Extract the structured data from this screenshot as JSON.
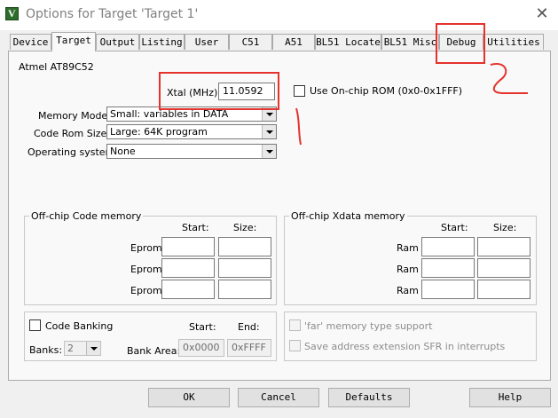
{
  "window": {
    "title": "Options for Target 'Target 1'",
    "close": "✕",
    "icon_letter": "V"
  },
  "tabs": [
    {
      "label": "Device"
    },
    {
      "label": "Target"
    },
    {
      "label": "Output"
    },
    {
      "label": "Listing"
    },
    {
      "label": "User"
    },
    {
      "label": "C51"
    },
    {
      "label": "A51"
    },
    {
      "label": "BL51 Locate"
    },
    {
      "label": "BL51 Misc"
    },
    {
      "label": "Debug"
    },
    {
      "label": "Utilities"
    }
  ],
  "active_tab": "Target",
  "target": {
    "device": "Atmel AT89C52",
    "xtal_label": "Xtal (MHz):",
    "xtal_value": "11.0592",
    "onchip_rom_label": "Use On-chip ROM (0x0-0x1FFF)",
    "memory_model_label": "Memory Model:",
    "memory_model_value": "Small: variables in DATA",
    "code_rom_label": "Code Rom Size:",
    "code_rom_value": "Large: 64K program",
    "os_label": "Operating system:",
    "os_value": "None"
  },
  "code_memory": {
    "title": "Off-chip Code memory",
    "start_label": "Start:",
    "size_label": "Size:",
    "rows": [
      "Eprom",
      "Eprom",
      "Eprom"
    ]
  },
  "xdata_memory": {
    "title": "Off-chip Xdata memory",
    "start_label": "Start:",
    "size_label": "Size:",
    "rows": [
      "Ram",
      "Ram",
      "Ram"
    ]
  },
  "banking": {
    "code_banking_label": "Code Banking",
    "start_label": "Start:",
    "end_label": "End:",
    "banks_label": "Banks:",
    "banks_value": "2",
    "bank_area_label": "Bank Area:",
    "bank_area_start": "0x0000",
    "bank_area_end": "0xFFFF"
  },
  "far_options": {
    "far_memory_label": "'far' memory type support",
    "save_sfr_label": "Save address extension SFR in interrupts"
  },
  "buttons": {
    "ok": "OK",
    "cancel": "Cancel",
    "defaults": "Defaults",
    "help": "Help"
  },
  "colors": {
    "annotation_red": "#e5322d"
  }
}
